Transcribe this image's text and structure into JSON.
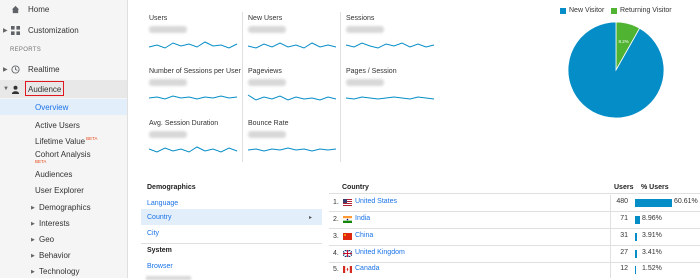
{
  "sidebar": {
    "home": "Home",
    "customization": "Customization",
    "section_reports": "REPORTS",
    "realtime": "Realtime",
    "audience": "Audience",
    "sub_items": {
      "overview": "Overview",
      "active_users": "Active Users",
      "lifetime_value": "Lifetime Value",
      "cohort_analysis": "Cohort Analysis",
      "audiences": "Audiences",
      "user_explorer": "User Explorer",
      "demographics": "Demographics",
      "interests": "Interests",
      "geo": "Geo",
      "behavior": "Behavior",
      "technology": "Technology"
    },
    "beta": "BETA"
  },
  "metrics": [
    {
      "label": "Users"
    },
    {
      "label": "New Users"
    },
    {
      "label": "Sessions"
    },
    {
      "label": "Number of Sessions per User"
    },
    {
      "label": "Pageviews"
    },
    {
      "label": "Pages / Session"
    },
    {
      "label": "Avg. Session Duration"
    },
    {
      "label": "Bounce Rate"
    }
  ],
  "pie": {
    "legend": [
      {
        "label": "New Visitor",
        "color": "#058dc7"
      },
      {
        "label": "Returning Visitor",
        "color": "#50b432"
      }
    ],
    "slices": [
      {
        "label": "91.8%",
        "value": 91.8,
        "color": "#058dc7"
      },
      {
        "label": "8.2%",
        "value": 8.2,
        "color": "#50b432"
      }
    ]
  },
  "demographics": {
    "heading": "Demographics",
    "items": [
      "Language",
      "Country",
      "City"
    ],
    "selected": "Country",
    "system_heading": "System",
    "system_items": [
      "Browser"
    ]
  },
  "country_table": {
    "col_country": "Country",
    "col_users": "Users",
    "col_pct": "% Users",
    "rows": [
      {
        "rank": "1.",
        "country": "United States",
        "users": "480",
        "pct": "60.61%",
        "pct_value": 60.61
      },
      {
        "rank": "2.",
        "country": "India",
        "users": "71",
        "pct": "8.96%",
        "pct_value": 8.96
      },
      {
        "rank": "3.",
        "country": "China",
        "users": "31",
        "pct": "3.91%",
        "pct_value": 3.91
      },
      {
        "rank": "4.",
        "country": "United Kingdom",
        "users": "27",
        "pct": "3.41%",
        "pct_value": 3.41
      },
      {
        "rank": "5.",
        "country": "Canada",
        "users": "12",
        "pct": "1.52%",
        "pct_value": 1.52
      }
    ]
  },
  "colors": {
    "accent": "#1a73e8",
    "series": "#058dc7",
    "highlight_box": "#e0171f"
  }
}
